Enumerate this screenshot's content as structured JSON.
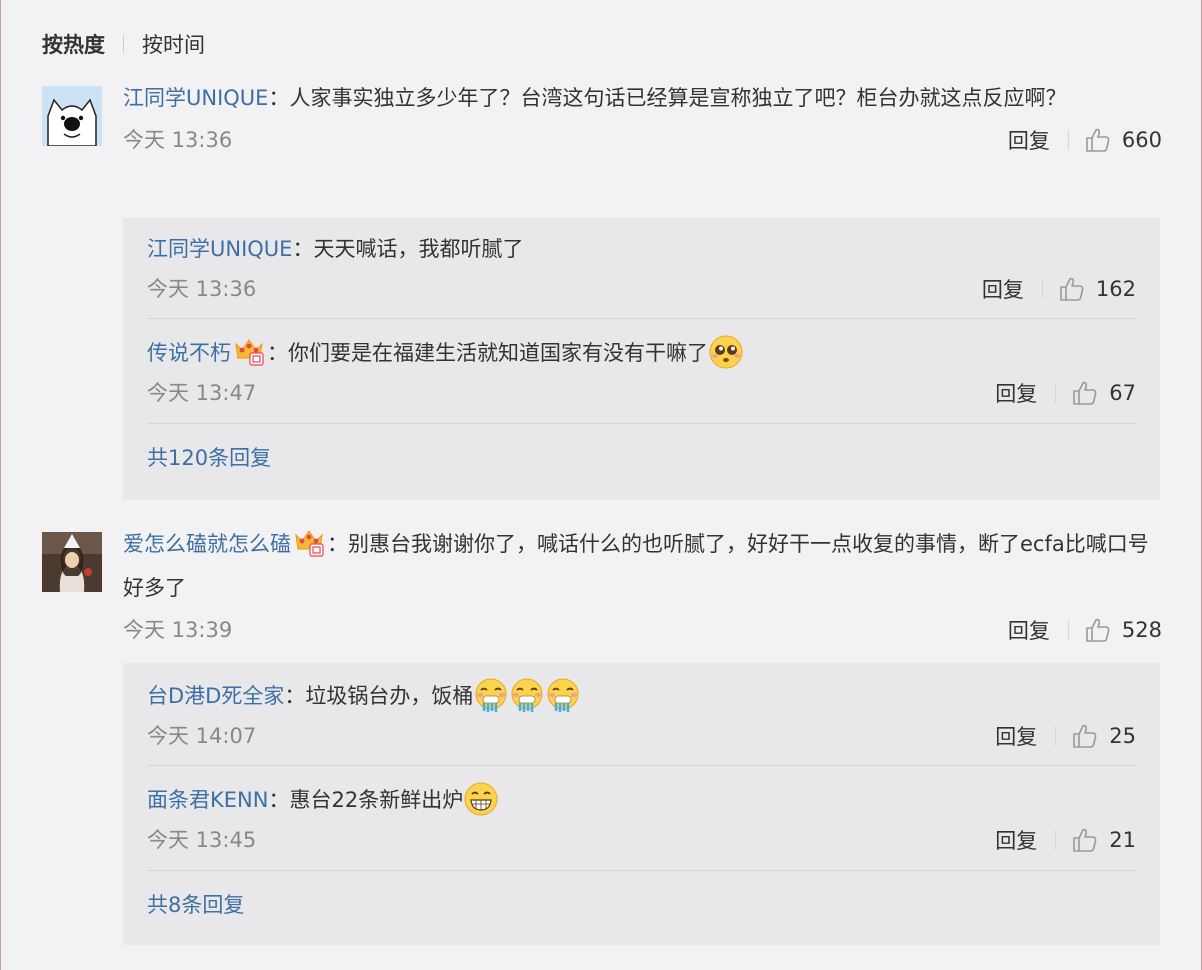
{
  "sort": {
    "hot": "按热度",
    "time": "按时间"
  },
  "comments": [
    {
      "user": "江同学UNIQUE",
      "sep": "：",
      "text": "人家事实独立多少年了？台湾这句话已经算是宣称独立了吧？柜台办就这点反应啊？",
      "time": "今天 13:36",
      "reply": "回复",
      "likes": "660",
      "replies": [
        {
          "user": "江同学UNIQUE",
          "sep": "：",
          "text": "天天喊话，我都听腻了",
          "time": "今天 13:36",
          "reply": "回复",
          "likes": "162"
        },
        {
          "user": "传说不朽",
          "sep": "：",
          "text": "你们要是在福建生活就知道国家有没有干嘛了",
          "time": "今天 13:47",
          "reply": "回复",
          "likes": "67"
        }
      ],
      "more": "共120条回复"
    },
    {
      "user": "爱怎么磕就怎么磕",
      "sep": "：",
      "text": "别惠台我谢谢你了，喊话什么的也听腻了，好好干一点收复的事情，断了ecfa比喊口号好多了",
      "time": "今天 13:39",
      "reply": "回复",
      "likes": "528",
      "replies": [
        {
          "user": "台D港D死全家",
          "sep": "：",
          "text": "垃圾锅台办，饭桶",
          "time": "今天 14:07",
          "reply": "回复",
          "likes": "25"
        },
        {
          "user": "面条君KENN",
          "sep": "：",
          "text": "惠台22条新鲜出炉",
          "time": "今天 13:45",
          "reply": "回复",
          "likes": "21"
        }
      ],
      "more": "共8条回复"
    }
  ],
  "colors": {
    "link": "#3e6fa4",
    "background": "#f2f2f5",
    "subbox": "#e8e8eb"
  },
  "icons": [
    "thumbs-up-icon",
    "vip-crown-icon",
    "pleading-emoji-icon",
    "vomit-emoji-icon",
    "grin-emoji-icon"
  ]
}
